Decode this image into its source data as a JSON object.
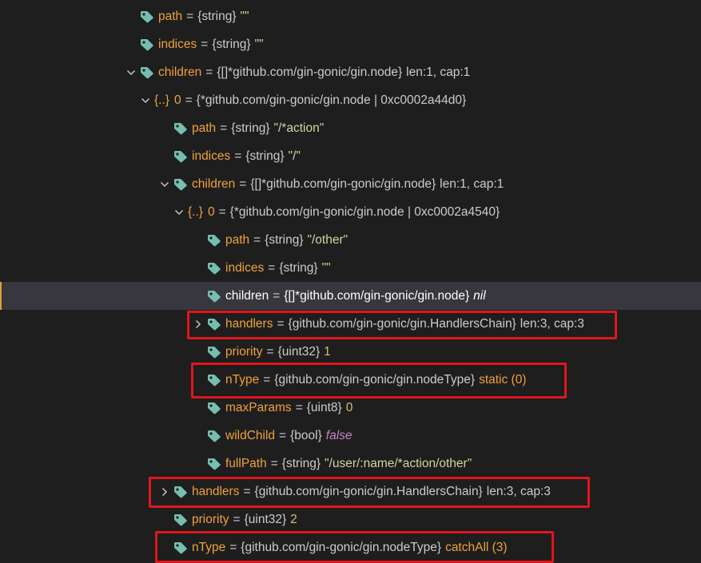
{
  "tree": [
    {
      "indent": 175,
      "chevron": "",
      "kind": "leaf",
      "name": "path",
      "type": "{string}",
      "value": "\"\"",
      "valueClass": "val-str2"
    },
    {
      "indent": 175,
      "chevron": "",
      "kind": "leaf",
      "name": "indices",
      "type": "{string}",
      "value": "\"\"",
      "valueClass": "val-str2"
    },
    {
      "indent": 157,
      "chevron": "down",
      "kind": "leaf",
      "name": "children",
      "type": "{[]*github.com/gin-gonic/gin.node}",
      "value": "len:1, cap:1",
      "valueClass": "val-plain"
    },
    {
      "indent": 175,
      "chevron": "down",
      "kind": "obj",
      "name": "{..}",
      "index": "0",
      "type": "{*github.com/gin-gonic/gin.node | 0xc0002a44d0}"
    },
    {
      "indent": 217,
      "chevron": "",
      "kind": "leaf",
      "name": "path",
      "type": "{string}",
      "value": "\"/*action\"",
      "valueClass": "val-str2"
    },
    {
      "indent": 217,
      "chevron": "",
      "kind": "leaf",
      "name": "indices",
      "type": "{string}",
      "value": "\"/\"",
      "valueClass": "val-str2"
    },
    {
      "indent": 199,
      "chevron": "down",
      "kind": "leaf",
      "name": "children",
      "type": "{[]*github.com/gin-gonic/gin.node}",
      "value": "len:1, cap:1",
      "valueClass": "val-plain"
    },
    {
      "indent": 217,
      "chevron": "down",
      "kind": "obj",
      "name": "{..}",
      "index": "0",
      "type": "{*github.com/gin-gonic/gin.node | 0xc0002a4540}"
    },
    {
      "indent": 259,
      "chevron": "",
      "kind": "leaf",
      "name": "path",
      "type": "{string}",
      "value": "\"/other\"",
      "valueClass": "val-str2"
    },
    {
      "indent": 259,
      "chevron": "",
      "kind": "leaf",
      "name": "indices",
      "type": "{string}",
      "value": "\"\"",
      "valueClass": "val-str2"
    },
    {
      "indent": 259,
      "chevron": "",
      "kind": "leaf",
      "name": "children",
      "type": "{[]*github.com/gin-gonic/gin.node}",
      "value": "nil",
      "valueClass": "val-nil",
      "selected": true
    },
    {
      "indent": 241,
      "chevron": "right",
      "kind": "leaf",
      "name": "handlers",
      "type": "{github.com/gin-gonic/gin.HandlersChain}",
      "value": "len:3, cap:3",
      "valueClass": "val-plain"
    },
    {
      "indent": 259,
      "chevron": "",
      "kind": "leaf",
      "name": "priority",
      "type": "{uint32}",
      "value": "1",
      "valueClass": "val-num"
    },
    {
      "indent": 259,
      "chevron": "",
      "kind": "leaf",
      "name": "nType",
      "type": "{github.com/gin-gonic/gin.nodeType}",
      "value": "static (0)",
      "valueClass": "val-enum"
    },
    {
      "indent": 259,
      "chevron": "",
      "kind": "leaf",
      "name": "maxParams",
      "type": "{uint8}",
      "value": "0",
      "valueClass": "val-num"
    },
    {
      "indent": 259,
      "chevron": "",
      "kind": "leaf",
      "name": "wildChild",
      "type": "{bool}",
      "value": "false",
      "valueClass": "val-bool"
    },
    {
      "indent": 259,
      "chevron": "",
      "kind": "leaf",
      "name": "fullPath",
      "type": "{string}",
      "value": "\"/user/:name/*action/other\"",
      "valueClass": "val-str2"
    },
    {
      "indent": 199,
      "chevron": "right",
      "kind": "leaf",
      "name": "handlers",
      "type": "{github.com/gin-gonic/gin.HandlersChain}",
      "value": "len:3, cap:3",
      "valueClass": "val-plain"
    },
    {
      "indent": 217,
      "chevron": "",
      "kind": "leaf",
      "name": "priority",
      "type": "{uint32}",
      "value": "2",
      "valueClass": "val-num"
    },
    {
      "indent": 217,
      "chevron": "",
      "kind": "leaf",
      "name": "nType",
      "type": "{github.com/gin-gonic/gin.nodeType}",
      "value": "catchAll (3)",
      "valueClass": "val-enum"
    }
  ],
  "colors": {
    "background": "#1e1e1e",
    "selected_row": "#37373d",
    "highlight_box": "#e0161c",
    "variable_name": "#f0a23b",
    "tag_icon": "#75beb0"
  },
  "icons": {
    "expanded": "chevron-down-icon",
    "collapsed": "chevron-right-icon",
    "variable": "tag-icon"
  }
}
